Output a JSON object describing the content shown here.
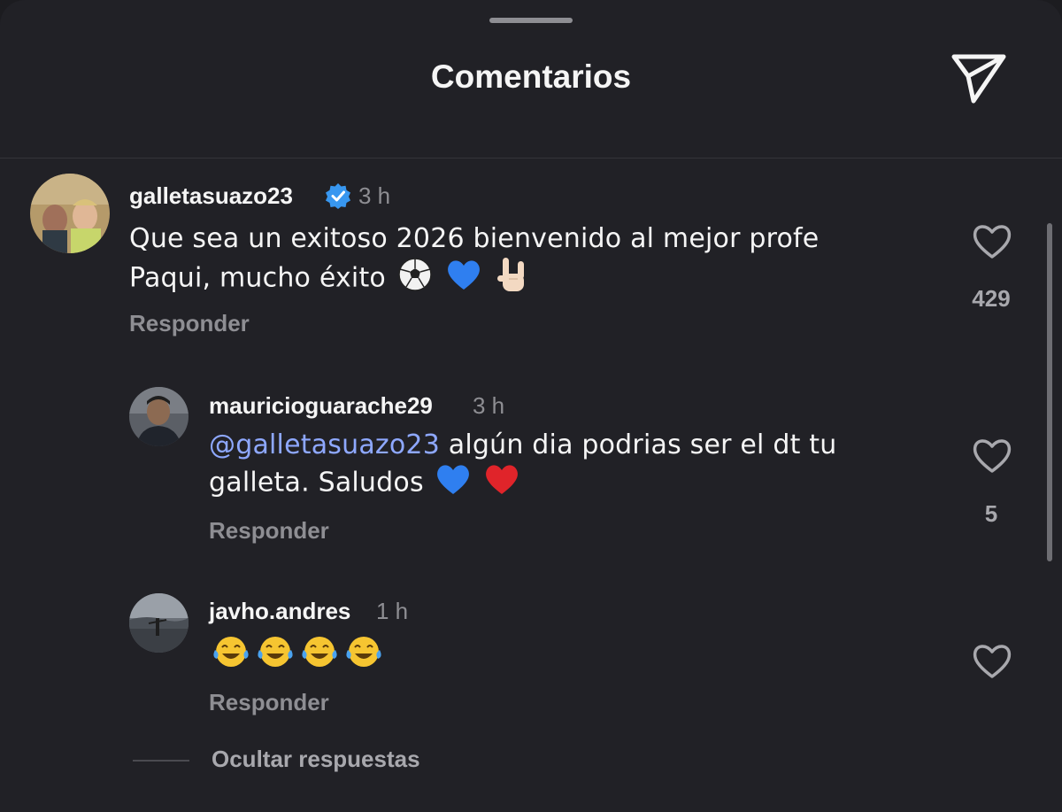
{
  "header": {
    "title": "Comentarios",
    "share_icon": "paper-plane-icon"
  },
  "comments": [
    {
      "username": "galletasuazo23",
      "verified": true,
      "time": "3 h",
      "text": "Que sea un exitoso 2026 bienvenido al mejor profe Paqui, mucho éxito",
      "emojis": [
        "soccer-ball",
        "blue-heart",
        "rock-on-hand"
      ],
      "reply_label": "Responder",
      "likes": "429"
    },
    {
      "username": "mauricioguarache29",
      "verified": false,
      "time": "3 h",
      "mention": "@galletasuazo23",
      "text": "algún dia podrias ser el dt tu galleta. Saludos",
      "emojis": [
        "blue-heart",
        "red-heart"
      ],
      "reply_label": "Responder",
      "likes": "5"
    },
    {
      "username": "javho.andres",
      "verified": false,
      "time": "1 h",
      "emojis": [
        "tears-of-joy",
        "tears-of-joy",
        "tears-of-joy",
        "tears-of-joy"
      ],
      "reply_label": "Responder",
      "likes": ""
    }
  ],
  "hide_replies_label": "Ocultar respuestas",
  "colors": {
    "background": "#212126",
    "text": "#f5f5f5",
    "muted": "#8e8e93",
    "mention": "#8ea8ff",
    "verified": "#3897f0"
  }
}
